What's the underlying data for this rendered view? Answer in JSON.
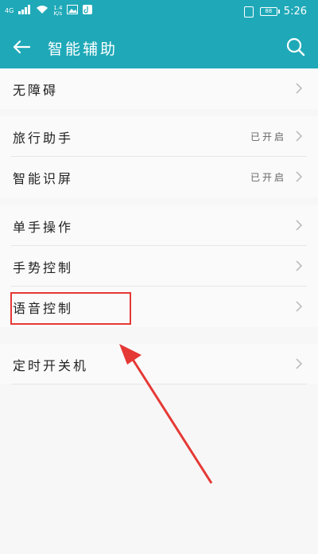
{
  "status_bar": {
    "network": "4G",
    "speed_value": "1.4",
    "speed_unit": "K/s",
    "battery": "88",
    "time": "5:26"
  },
  "app_bar": {
    "title": "智能辅助",
    "back_icon": "back-arrow-icon",
    "search_icon": "search-icon"
  },
  "settings": {
    "items": [
      {
        "label": "无障碍",
        "value": ""
      },
      {
        "label": "旅行助手",
        "value": "已开启"
      },
      {
        "label": "智能识屏",
        "value": "已开启"
      },
      {
        "label": "单手操作",
        "value": ""
      },
      {
        "label": "手势控制",
        "value": ""
      },
      {
        "label": "语音控制",
        "value": ""
      },
      {
        "label": "定时开关机",
        "value": ""
      }
    ]
  },
  "annotation": {
    "color": "#e53935"
  }
}
